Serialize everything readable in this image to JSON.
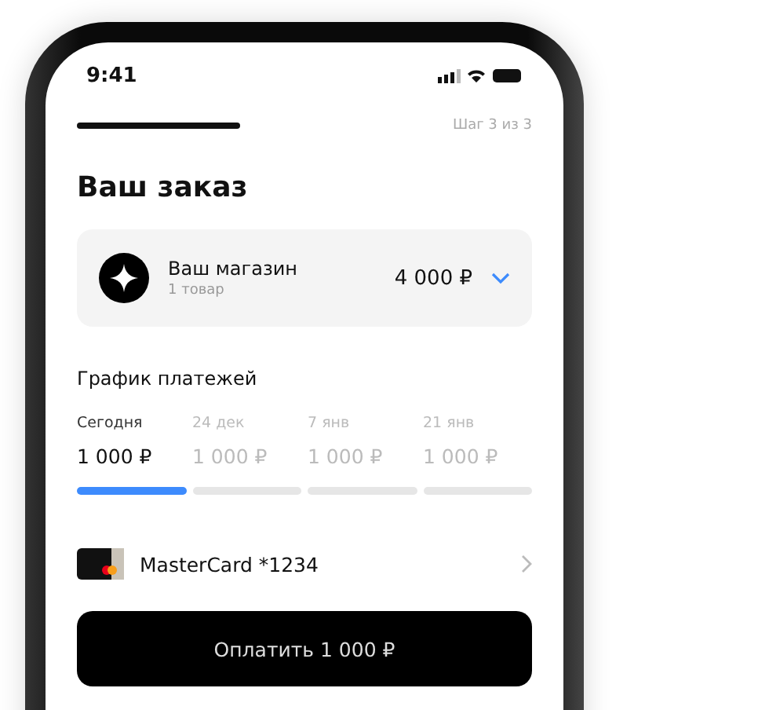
{
  "status_bar": {
    "time": "9:41"
  },
  "step": "Шаг 3 из 3",
  "title": "Ваш заказ",
  "order": {
    "shop": "Ваш магазин",
    "items": "1 товар",
    "total": "4 000 ₽",
    "expanded": false
  },
  "schedule": {
    "title": "График платежей",
    "payments": [
      {
        "date": "Сегодня",
        "amount": "1 000 ₽",
        "selected": true
      },
      {
        "date": "24 дек",
        "amount": "1 000 ₽",
        "selected": false
      },
      {
        "date": "7 янв",
        "amount": "1 000 ₽",
        "selected": false
      },
      {
        "date": "21 янв",
        "amount": "1 000 ₽",
        "selected": false
      }
    ]
  },
  "card": {
    "label": "MasterCard *1234"
  },
  "pay_button": "Оплатить 1 000 ₽"
}
